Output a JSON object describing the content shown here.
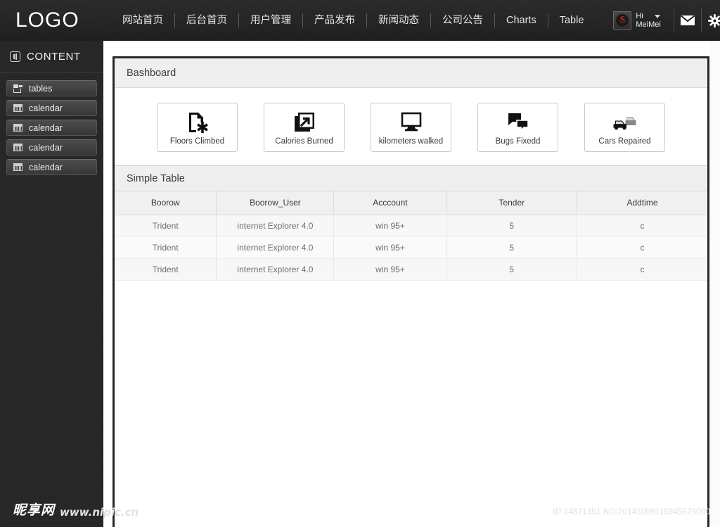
{
  "header": {
    "logo": "LOGO",
    "nav": [
      {
        "label": "网站首页"
      },
      {
        "label": "后台首页"
      },
      {
        "label": "用户管理"
      },
      {
        "label": "产品发布"
      },
      {
        "label": "新闻动态"
      },
      {
        "label": "公司公告"
      },
      {
        "label": "Charts"
      },
      {
        "label": "Table"
      }
    ],
    "user": {
      "avatar_letter": "S",
      "greeting": "Hi",
      "name": "MeiMei"
    },
    "icons": [
      {
        "name": "mail-icon"
      },
      {
        "name": "gear-icon"
      },
      {
        "name": "search-icon"
      }
    ]
  },
  "sidebar": {
    "title": "CONTENT",
    "title_icon": "dashboard-icon",
    "items": [
      {
        "label": "tables",
        "icon": "tables-icon"
      },
      {
        "label": "calendar",
        "icon": "calendar-icon"
      },
      {
        "label": "calendar",
        "icon": "calendar-icon"
      },
      {
        "label": "calendar",
        "icon": "calendar-icon"
      },
      {
        "label": "calendar",
        "icon": "calendar-icon"
      }
    ]
  },
  "dashboard": {
    "title": "Bashboard",
    "metrics": [
      {
        "label": "Floors Climbed",
        "icon": "document-star-icon"
      },
      {
        "label": "Calories Burned",
        "icon": "arrow-up-right-box-icon"
      },
      {
        "label": "kilometers walked",
        "icon": "monitor-icon"
      },
      {
        "label": "Bugs Fixedd",
        "icon": "speech-bubbles-icon"
      },
      {
        "label": "Cars Repaired",
        "icon": "cars-icon"
      }
    ]
  },
  "table_panel": {
    "title": "Simple Table",
    "columns": [
      "Boorow",
      "Boorow_User",
      "Acccount",
      "Tender",
      "Addtime"
    ],
    "rows": [
      [
        "Trident",
        "internet Explorer 4.0",
        "win 95+",
        "5",
        "c"
      ],
      [
        "Trident",
        "internet Explorer 4.0",
        "win 95+",
        "5",
        "c"
      ],
      [
        "Trident",
        "internet Explorer 4.0",
        "win 95+",
        "5",
        "c"
      ]
    ]
  },
  "watermark": {
    "brand_cn": "昵享网",
    "url": "www.nipic.cn",
    "id_text": "ID:14671351 NO:20141009115945575000"
  },
  "colors": {
    "header_bg": "#222222",
    "sidebar_bg": "#262626",
    "panel_border": "#272727",
    "panel_head_bg": "#efefef",
    "avatar_red": "#cc1f1f"
  }
}
